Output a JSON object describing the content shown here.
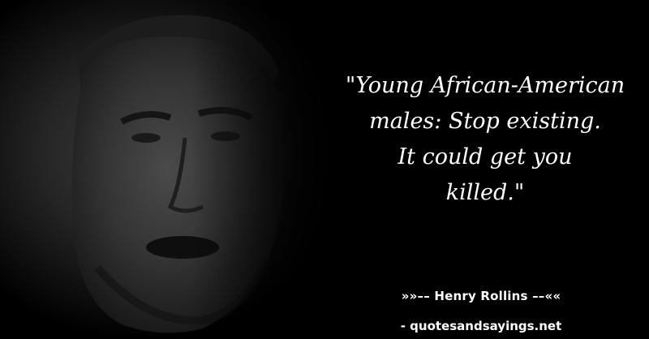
{
  "quote": {
    "text": "\"Young African-American\nmales: Stop existing.\nIt could get you\nkilled.\""
  },
  "author": {
    "line": "»»–– Henry Rollins ––««"
  },
  "source": {
    "line": "- quotesandsayings.net"
  },
  "photo": {
    "subject": "portrait-photo",
    "tone": "#2b2b2b"
  }
}
